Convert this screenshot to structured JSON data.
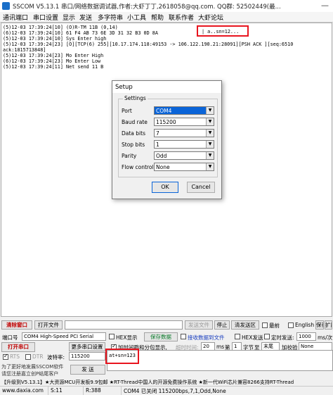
{
  "window": {
    "title": "SSCOM V5.13.1 串口/网络数据调试器,作者:大虾丁丁,2618058@qq.com. QQ群: 52502449(最...",
    "minimize_glyph": "—"
  },
  "menu": [
    "通讯端口",
    "串口设置",
    "显示",
    "发送",
    "多字符串",
    "小工具",
    "帮助",
    "联系作者",
    "大虾论坛"
  ],
  "console_lines": [
    "(5)12-03 17:39:24[10] (O)R-TM 11B (0,14)",
    "(6)12-03 17:39:24[10] 61 F4 AB 73 6E 3D 31 32 B3 0D 8A",
    "(5)12-03 17:39:24[10] Sys Enter high",
    "(5)12-03 17:39:24[23] [O][TCP(6) 255][10.17.174.118:49153 -> 106.122.190.21:28091][PSH ACK ][seq:6510",
    "ack:1815713848]",
    "(5)12-03 17:39:24[23] Mo Enter High",
    "(6)12-03 17:39:24[23] Mo Enter Low",
    "(5)12-03 17:39:24[11] Net send 11 B"
  ],
  "console_highlight": "| a..sn=12...",
  "setup_dialog": {
    "title": "Setup",
    "group_label": "Settings",
    "fields": [
      {
        "label": "Port",
        "value": "COM4"
      },
      {
        "label": "Baud rate",
        "value": "115200"
      },
      {
        "label": "Data bits",
        "value": "7"
      },
      {
        "label": "Stop bits",
        "value": "1"
      },
      {
        "label": "Parity",
        "value": "Odd"
      },
      {
        "label": "Flow control",
        "value": "None"
      }
    ],
    "ok_label": "OK",
    "cancel_label": "Cancel"
  },
  "toolbar": {
    "clear_label": "清除窗口",
    "open_file_label": "打开文件",
    "send_file_label": "发送文件",
    "stop_label": "停止",
    "clear_send_label": "清发送区",
    "top_label": "最前",
    "english_label": "English",
    "save_params_label": "保存参数",
    "expand_label": "扩展",
    "collapse_glyph": "—"
  },
  "port_row": {
    "port_label": "端口号",
    "port_value": "COM4 High-Speed PCI Serial",
    "hex_display_label": "HEX显示",
    "save_data_label": "保存数据",
    "receive_to_file_label": "接收数据到文件",
    "hex_send_label": "HEX发送",
    "timed_send_label": "定时发送:",
    "interval_value": "1000",
    "interval_unit": "ms/次",
    "add_newline_label": "加回车换行"
  },
  "open_row": {
    "open_button_label": "打开串口",
    "more_settings_label": "更多串口设置",
    "timestamp_label": "加时间戳和分包显示,",
    "timeout_label": "超时时间:",
    "timeout_value": "20",
    "timeout_unit": "ms",
    "packet_label": "第",
    "packet_value": "1",
    "byte_label": "字节",
    "to_label": "至",
    "end_value": "末尾",
    "checksum_label": "加校验",
    "checksum_value": "None"
  },
  "rts_row": {
    "rts_label": "RTS",
    "dtr_label": "DTR",
    "baud_label": "波特率:",
    "baud_value": "115200"
  },
  "send_text": "at+sn=123",
  "promo": {
    "line1": "为了更好地发展SSCOM软件",
    "line2": "请您注册嘉立创P结尾客户",
    "send_button_label": "发 送"
  },
  "ticker": "【升级到V5.13.1】★大资源MCU开发板9.9包邮 ★RT-Thread中国人的开源免费操作系统 ★新一代WiFi芯片兼容8266支持RT-Thread",
  "status": {
    "website": "www.daxia.com",
    "s_count": "S:11",
    "r_count": "R:388",
    "port_status": "COM4 已关闭  115200bps,7,1,Odd,None"
  }
}
